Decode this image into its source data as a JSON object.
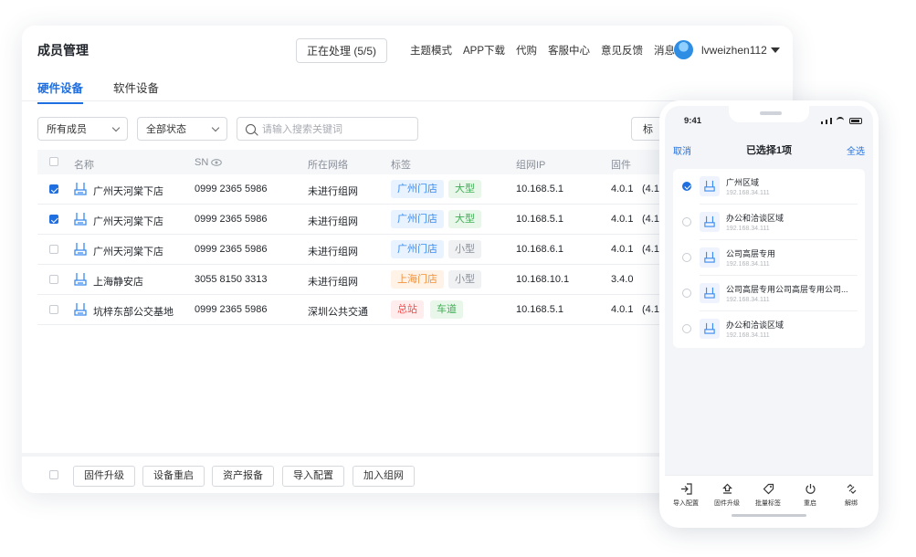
{
  "desktop": {
    "title": "成员管理",
    "processing_button": "正在处理 (5/5)",
    "nav": [
      "主题模式",
      "APP下载",
      "代购",
      "客服中心",
      "意见反馈",
      "消息"
    ],
    "username": "lvweizhen112",
    "tabs": [
      "硬件设备",
      "软件设备"
    ],
    "filters": {
      "member": "所有成员",
      "status": "全部状态",
      "search_placeholder": "请输入搜索关键词",
      "side_button": "标"
    },
    "columns": [
      "名称",
      "SN",
      "所在网络",
      "标签",
      "组网IP",
      "固件"
    ],
    "rows": [
      {
        "checked": true,
        "name": "广州天河棠下店",
        "sn": "0999 2365 5986",
        "network": "未进行组网",
        "tag1": "广州门店",
        "tag2": "大型",
        "ip": "10.168.5.1",
        "firmware": "4.0.1",
        "firmware2": "(4.1"
      },
      {
        "checked": true,
        "name": "广州天河棠下店",
        "sn": "0999 2365 5986",
        "network": "未进行组网",
        "tag1": "广州门店",
        "tag2": "大型",
        "ip": "10.168.5.1",
        "firmware": "4.0.1",
        "firmware2": "(4.1"
      },
      {
        "checked": false,
        "name": "广州天河棠下店",
        "sn": "0999 2365 5986",
        "network": "未进行组网",
        "tag1": "广州门店",
        "tag2": "小型",
        "ip": "10.168.6.1",
        "firmware": "4.0.1",
        "firmware2": "(4.1"
      },
      {
        "checked": false,
        "name": "上海静安店",
        "sn": "3055 8150 3313",
        "network": "未进行组网",
        "tag1": "上海门店",
        "tag2": "小型",
        "ip": "10.168.10.1",
        "firmware": "3.4.0",
        "firmware2": ""
      },
      {
        "checked": false,
        "name": "坑梓东部公交基地",
        "sn": "0999 2365 5986",
        "network": "深圳公共交通",
        "tag1": "总站",
        "tag2": "车道",
        "ip": "10.168.5.1",
        "firmware": "4.0.1",
        "firmware2": "(4.1"
      }
    ],
    "footer_buttons": [
      "固件升级",
      "设备重启",
      "资产报备",
      "导入配置",
      "加入组网"
    ]
  },
  "phone": {
    "time": "9:41",
    "cancel": "取消",
    "title": "已选择1项",
    "select_all": "全选",
    "items": [
      {
        "name": "广州区域",
        "ip": "192.168.34.111",
        "selected": true
      },
      {
        "name": "办公和洽谈区域",
        "ip": "192.168.34.111",
        "selected": false
      },
      {
        "name": "公司高层专用",
        "ip": "192.168.34.111",
        "selected": false
      },
      {
        "name": "公司高层专用公司高层专用公司...",
        "ip": "192.168.34.111",
        "selected": false
      },
      {
        "name": "办公和洽谈区域",
        "ip": "192.168.34.111",
        "selected": false
      }
    ],
    "actions": [
      "导入配置",
      "固件升级",
      "批量标签",
      "重启",
      "解绑"
    ]
  }
}
